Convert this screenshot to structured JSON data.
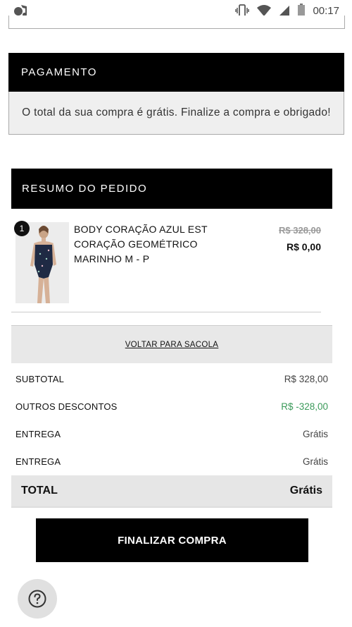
{
  "status_bar": {
    "time": "00:17",
    "icons": [
      "app-notification-icon",
      "vibrate-icon",
      "wifi-icon",
      "signal-icon",
      "battery-icon"
    ]
  },
  "payment": {
    "title": "PAGAMENTO",
    "message": "O total da sua compra é grátis. Finalize a compra e obrigado!"
  },
  "summary": {
    "title": "RESUMO DO PEDIDO",
    "item": {
      "quantity": "1",
      "name": "BODY CORAÇÃO AZUL EST CORAÇÃO GEOMÉTRICO MARINHO M - P",
      "price_old": "R$ 328,00",
      "price_new": "R$ 0,00"
    },
    "back_link": "VOLTAR PARA SACOLA",
    "rows": [
      {
        "label": "SUBTOTAL",
        "value": "R$ 328,00"
      },
      {
        "label": "OUTROS DESCONTOS",
        "value": "R$ -328,00"
      },
      {
        "label": "ENTREGA",
        "value": "Grátis"
      },
      {
        "label": "ENTREGA",
        "value": "Grátis"
      }
    ],
    "total": {
      "label": "TOTAL",
      "value": "Grátis"
    }
  },
  "finalize_button": "FINALIZAR COMPRA",
  "colors": {
    "discount": "#3b9a5a",
    "header_bg": "#000000"
  }
}
